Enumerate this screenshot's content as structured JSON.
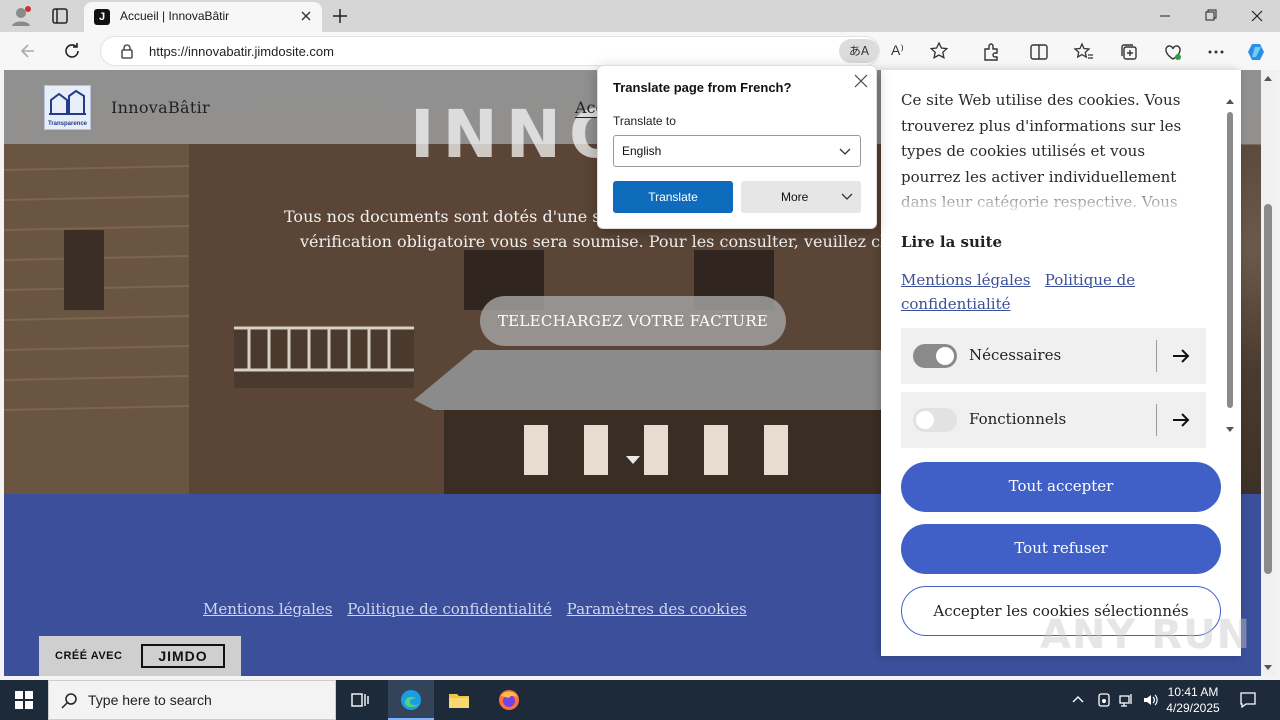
{
  "browser": {
    "tab_title": "Accueil | InnovaBâtir",
    "tab_favicon_letter": "J",
    "url": "https://innovabatir.jimdosite.com",
    "translate_icon_glyph": "あA",
    "read_aloud_glyph": "A⁾"
  },
  "translate_popup": {
    "title": "Translate page from French?",
    "translate_to_label": "Translate to",
    "selected_language": "English",
    "translate_button": "Translate",
    "more_button": "More"
  },
  "site": {
    "logo_caption": "Transparence",
    "name": "InnovaBâtir",
    "nav_item": "Acc",
    "hero_title": "INNO",
    "hero_text_line1": "Tous nos documents sont dotés d'une sécu",
    "hero_text_line2": "vérification obligatoire vous sera soumise. Pour les consulter, veuillez cliquer c",
    "cta_button": "TELECHARGEZ VOTRE FACTURE",
    "footer_links": [
      "Mentions légales",
      "Politique de confidentialité",
      "Paramètres des cookies"
    ],
    "jimdo_label": "CRÉÉ AVEC",
    "jimdo_brand": "JIMDO"
  },
  "cookie_panel": {
    "text": "Ce site Web utilise des cookies. Vous trouverez plus d'informations sur les types de cookies utilisés et vous pourrez les activer individuellement dans leur catégorie respective. Vous pouvez",
    "read_more": "Lire la suite",
    "link_legal": "Mentions légales",
    "link_privacy": "Politique de confidentialité",
    "categories": [
      {
        "label": "Nécessaires",
        "enabled": true
      },
      {
        "label": "Fonctionnels",
        "enabled": false
      }
    ],
    "accept_all": "Tout accepter",
    "refuse_all": "Tout refuser",
    "accept_selected": "Accepter les cookies sélectionnés",
    "accent_color": "#4060c8"
  },
  "watermark": "ANY RUN",
  "taskbar": {
    "search_placeholder": "Type here to search",
    "time": "10:41 AM",
    "date": "4/29/2025"
  }
}
